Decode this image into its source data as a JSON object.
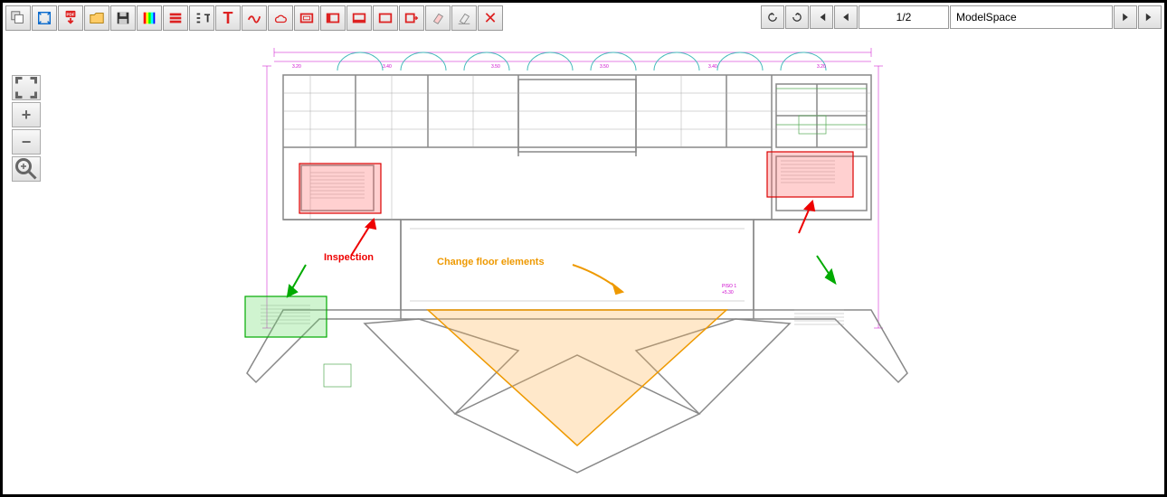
{
  "toolbar": {
    "tools": [
      "layers",
      "fit",
      "pdf",
      "open",
      "save",
      "colors",
      "list",
      "text-left",
      "text",
      "draw",
      "shape",
      "rect-add",
      "rect-left",
      "rect-sel",
      "rect-out",
      "rect-cut",
      "erase",
      "erase2",
      "delete"
    ]
  },
  "nav": {
    "page": "1/2",
    "model": "ModelSpace"
  },
  "side": [
    "expand",
    "plus",
    "minus",
    "zoom"
  ],
  "annotations": {
    "inspection": "Inspection",
    "change": "Change floor elements"
  },
  "colors": {
    "red": "#e00",
    "green": "#0a0",
    "orange": "#e90"
  }
}
